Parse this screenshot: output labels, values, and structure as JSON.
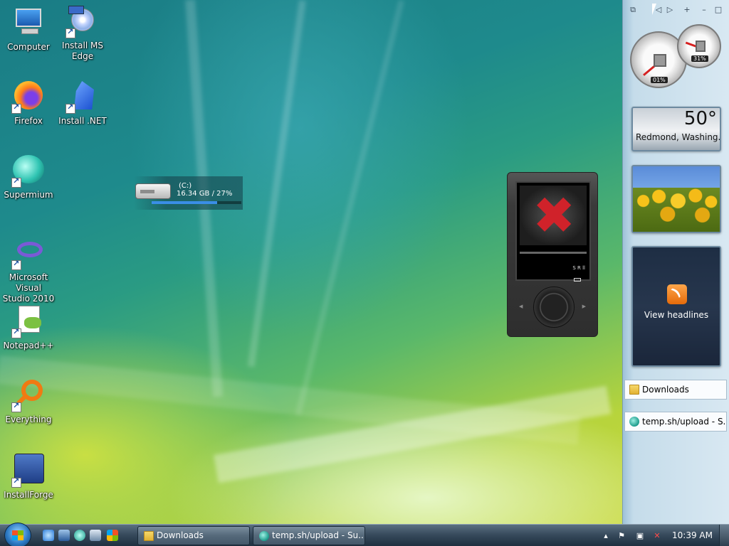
{
  "desktop": {
    "icons": [
      {
        "label": "Computer",
        "icon": "computer-icon"
      },
      {
        "label": "Install MS Edge",
        "icon": "install-cd-icon"
      },
      {
        "label": "Firefox",
        "icon": "firefox-icon"
      },
      {
        "label": "Install .NET",
        "icon": "dotnet-installer-icon"
      },
      {
        "label": "Supermium",
        "icon": "supermium-icon"
      },
      {
        "label": "Microsoft Visual Studio 2010",
        "icon": "visual-studio-icon"
      },
      {
        "label": "Notepad++",
        "icon": "notepadpp-icon"
      },
      {
        "label": "Everything",
        "icon": "everything-search-icon"
      },
      {
        "label": "InstallForge",
        "icon": "installforge-icon"
      }
    ]
  },
  "drive_gadget": {
    "drive": "(C:)",
    "space": "16.34 GB / 27%",
    "used_fraction": 0.73
  },
  "zune_gadget": {
    "status_icon": "error-x-icon",
    "side_text": "S R ll"
  },
  "sidebar": {
    "toolbar": {
      "icons": [
        "gadget-gallery-icon",
        "previous-icon",
        "next-icon",
        "add-gadget-icon",
        "minimize-icon"
      ]
    },
    "cpu_meter": {
      "cpu": "01%",
      "memory": "31%"
    },
    "weather": {
      "temperature": "50°",
      "location": "Redmond, Washing..."
    },
    "feeds": {
      "label": "View headlines"
    },
    "items": [
      {
        "label": "Downloads",
        "icon": "folder-icon"
      },
      {
        "label": "temp.sh/upload - S...",
        "icon": "supermium-icon"
      }
    ]
  },
  "taskbar": {
    "start_icon": "windows-start-icon",
    "quick_launch": [
      "internet-explorer-icon",
      "show-desktop-icon",
      "supermium-icon",
      "switch-windows-icon",
      "windows-icon"
    ],
    "buttons": [
      {
        "label": "Downloads",
        "icon": "folder-icon"
      },
      {
        "label": "temp.sh/upload - Su...",
        "icon": "supermium-icon"
      }
    ],
    "tray": {
      "icons": [
        "chevron-up-icon",
        "flag-icon",
        "network-icon",
        "volume-muted-icon"
      ],
      "time": "10:39 AM"
    }
  },
  "colors": {
    "sidebar_bg": "#c5dcea",
    "taskbar_bg": "#35485a",
    "error_red": "#d0222a",
    "drive_bar": "#3a8ee6"
  }
}
